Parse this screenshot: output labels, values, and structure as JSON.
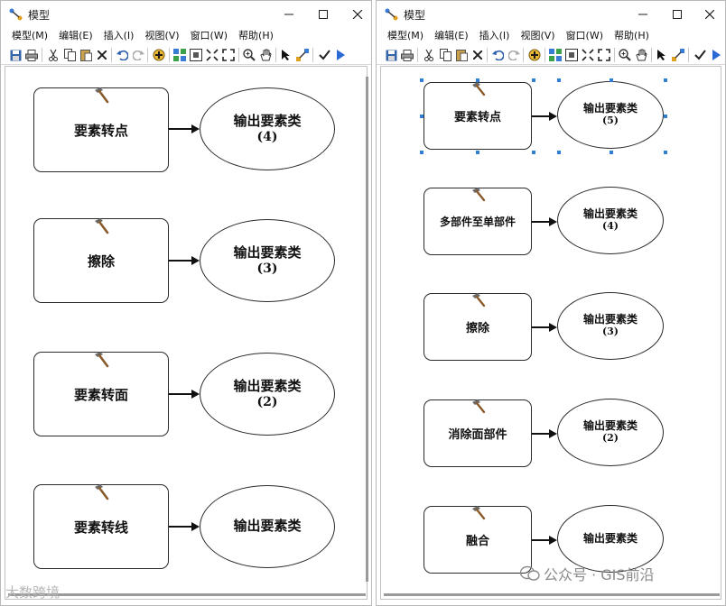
{
  "windows": [
    {
      "title": "模型",
      "menu": [
        "模型(M)",
        "编辑(E)",
        "插入(I)",
        "视图(V)",
        "窗口(W)",
        "帮助(H)"
      ],
      "rows": [
        {
          "tool": "要素转点",
          "output": "输出要素类",
          "num": "(4)"
        },
        {
          "tool": "擦除",
          "output": "输出要素类",
          "num": "(3)"
        },
        {
          "tool": "要素转面",
          "output": "输出要素类",
          "num": "(2)"
        },
        {
          "tool": "要素转线",
          "output": "输出要素类",
          "num": ""
        }
      ]
    },
    {
      "title": "模型",
      "menu": [
        "模型(M)",
        "编辑(E)",
        "插入(I)",
        "视图(V)",
        "窗口(W)",
        "帮助(H)"
      ],
      "rows": [
        {
          "tool": "要素转点",
          "output": "输出要素类",
          "num": "(5)",
          "selected": true
        },
        {
          "tool": "多部件至单部件",
          "output": "输出要素类",
          "num": "(4)"
        },
        {
          "tool": "擦除",
          "output": "输出要素类",
          "num": "(3)"
        },
        {
          "tool": "消除面部件",
          "output": "输出要素类",
          "num": "(2)"
        },
        {
          "tool": "融合",
          "output": "输出要素类",
          "num": ""
        }
      ]
    }
  ],
  "watermark": {
    "left_text": "大数跨境",
    "right_text": "公众号 · GIS前沿"
  },
  "icons": [
    "model-app-icon",
    "minimize-icon",
    "maximize-icon",
    "close-icon",
    "save-icon",
    "print-icon",
    "cut-icon",
    "copy-icon",
    "paste-icon",
    "delete-icon",
    "undo-icon",
    "redo-icon",
    "add-data-icon",
    "auto-layout-icon",
    "full-extent-icon",
    "fixed-zoom-in-icon",
    "fixed-zoom-out-icon",
    "zoom-in-icon",
    "pan-icon",
    "select-icon",
    "connect-icon",
    "validate-icon",
    "run-icon",
    "hammer-icon"
  ]
}
